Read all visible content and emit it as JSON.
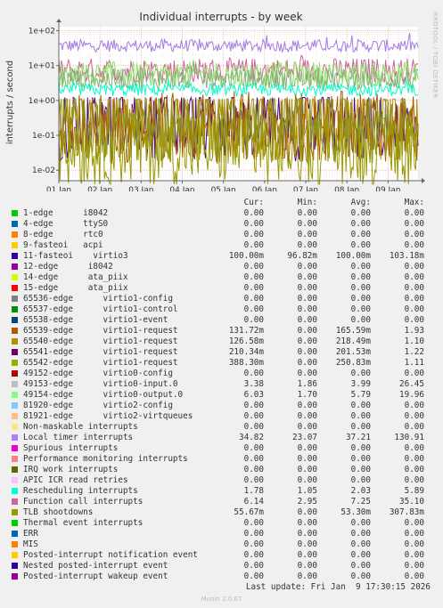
{
  "chart_data": {
    "type": "line",
    "title": "Individual interrupts - by week",
    "ylabel": "interrupts / second",
    "yscale": "log",
    "ylim": [
      0.005,
      130
    ],
    "ytick_labels": [
      "1e-02",
      "1e-01",
      "1e+00",
      "1e+01",
      "1e+02"
    ],
    "yticks": [
      0.01,
      0.1,
      1,
      10,
      100
    ],
    "xtick_labels": [
      "01 Jan",
      "02 Jan",
      "03 Jan",
      "04 Jan",
      "05 Jan",
      "06 Jan",
      "07 Jan",
      "08 Jan",
      "09 Jan"
    ],
    "xlim": [
      "01 Jan",
      "09 Jan 17:30"
    ],
    "grid": true,
    "watermark": "RRDTOOL / TOBI OETIKER",
    "series": [
      {
        "name": "Local timer interrupts",
        "color": "#a57be2",
        "avg": 37.21,
        "min": 23.07,
        "max": 130.91,
        "noise": 0.06
      },
      {
        "name": "Function call interrupts",
        "color": "#cc6699",
        "avg": 7.25,
        "min": 2.95,
        "max": 35.1,
        "noise": 0.12
      },
      {
        "name": "49154-edge virtio0-output.0",
        "color": "#8ee565",
        "avg": 5.79,
        "min": 1.7,
        "max": 19.96,
        "noise": 0.12
      },
      {
        "name": "49153-edge virtio0-input.0",
        "color": "#85b27a",
        "avg": 3.99,
        "min": 1.86,
        "max": 26.45,
        "noise": 0.1
      },
      {
        "name": "Rescheduling interrupts",
        "color": "#00ffcc",
        "avg": 2.03,
        "min": 1.05,
        "max": 5.89,
        "noise": 0.06
      },
      {
        "name": "65541-edge virtio1-request",
        "color": "#550088",
        "avg": 0.2015,
        "min": 0.01,
        "max": 1.22,
        "noise": 0.35
      },
      {
        "name": "65540-edge virtio1-request",
        "color": "#b89000",
        "avg": 0.2185,
        "min": 0.01,
        "max": 1.1,
        "noise": 0.35
      },
      {
        "name": "65539-edge virtio1-request",
        "color": "#a85c00",
        "avg": 0.1656,
        "min": 0.01,
        "max": 1.93,
        "noise": 0.35
      },
      {
        "name": "65542-edge virtio1-request",
        "color": "#889922",
        "avg": 0.2508,
        "min": 0.004,
        "max": 1.11,
        "noise": 0.4
      },
      {
        "name": "TLB shootdowns",
        "color": "#999900",
        "avg": 0.0533,
        "min": 0.004,
        "max": 0.3078,
        "noise": 0.4
      }
    ]
  },
  "legend": {
    "headers": {
      "cur": "Cur:",
      "min": "Min:",
      "avg": "Avg:",
      "max": "Max:"
    },
    "rows": [
      {
        "label": "1-edge      i8042",
        "color": "#00cc00",
        "cur": "0.00",
        "min": "0.00",
        "avg": "0.00",
        "max": "0.00"
      },
      {
        "label": "4-edge      ttyS0",
        "color": "#0066b3",
        "cur": "0.00",
        "min": "0.00",
        "avg": "0.00",
        "max": "0.00"
      },
      {
        "label": "8-edge      rtc0",
        "color": "#ff8000",
        "cur": "0.00",
        "min": "0.00",
        "avg": "0.00",
        "max": "0.00"
      },
      {
        "label": "9-fasteoi   acpi",
        "color": "#ffcc00",
        "cur": "0.00",
        "min": "0.00",
        "avg": "0.00",
        "max": "0.00"
      },
      {
        "label": "11-fasteoi    virtio3",
        "color": "#330099",
        "cur": "100.00m",
        "min": "96.82m",
        "avg": "100.00m",
        "max": "103.18m"
      },
      {
        "label": "12-edge      i8042",
        "color": "#990099",
        "cur": "0.00",
        "min": "0.00",
        "avg": "0.00",
        "max": "0.00"
      },
      {
        "label": "14-edge      ata_piix",
        "color": "#ccff00",
        "cur": "0.00",
        "min": "0.00",
        "avg": "0.00",
        "max": "0.00"
      },
      {
        "label": "15-edge      ata_piix",
        "color": "#ff0000",
        "cur": "0.00",
        "min": "0.00",
        "avg": "0.00",
        "max": "0.00"
      },
      {
        "label": "65536-edge      virtio1-config",
        "color": "#808080",
        "cur": "0.00",
        "min": "0.00",
        "avg": "0.00",
        "max": "0.00"
      },
      {
        "label": "65537-edge      virtio1-control",
        "color": "#008f00",
        "cur": "0.00",
        "min": "0.00",
        "avg": "0.00",
        "max": "0.00"
      },
      {
        "label": "65538-edge      virtio1-event",
        "color": "#00487d",
        "cur": "0.00",
        "min": "0.00",
        "avg": "0.00",
        "max": "0.00"
      },
      {
        "label": "65539-edge      virtio1-request",
        "color": "#b35a00",
        "cur": "131.72m",
        "min": "0.00",
        "avg": "165.59m",
        "max": "1.93"
      },
      {
        "label": "65540-edge      virtio1-request",
        "color": "#b38f00",
        "cur": "126.58m",
        "min": "0.00",
        "avg": "218.49m",
        "max": "1.10"
      },
      {
        "label": "65541-edge      virtio1-request",
        "color": "#6b006b",
        "cur": "210.34m",
        "min": "0.00",
        "avg": "201.53m",
        "max": "1.22"
      },
      {
        "label": "65542-edge      virtio1-request",
        "color": "#8fb300",
        "cur": "388.30m",
        "min": "0.00",
        "avg": "250.83m",
        "max": "1.11"
      },
      {
        "label": "49152-edge      virtio0-config",
        "color": "#b30000",
        "cur": "0.00",
        "min": "0.00",
        "avg": "0.00",
        "max": "0.00"
      },
      {
        "label": "49153-edge      virtio0-input.0",
        "color": "#bebebe",
        "cur": "3.38",
        "min": "1.86",
        "avg": "3.99",
        "max": "26.45"
      },
      {
        "label": "49154-edge      virtio0-output.0",
        "color": "#80ff80",
        "cur": "6.03",
        "min": "1.70",
        "avg": "5.79",
        "max": "19.96"
      },
      {
        "label": "81920-edge      virtio2-config",
        "color": "#80c9ff",
        "cur": "0.00",
        "min": "0.00",
        "avg": "0.00",
        "max": "0.00"
      },
      {
        "label": "81921-edge      virtio2-virtqueues",
        "color": "#ffc080",
        "cur": "0.00",
        "min": "0.00",
        "avg": "0.00",
        "max": "0.00"
      },
      {
        "label": "Non-maskable interrupts",
        "color": "#ffe680",
        "cur": "0.00",
        "min": "0.00",
        "avg": "0.00",
        "max": "0.00"
      },
      {
        "label": "Local timer interrupts",
        "color": "#aa80ff",
        "cur": "34.82",
        "min": "23.07",
        "avg": "37.21",
        "max": "130.91"
      },
      {
        "label": "Spurious interrupts",
        "color": "#ee00cc",
        "cur": "0.00",
        "min": "0.00",
        "avg": "0.00",
        "max": "0.00"
      },
      {
        "label": "Performance monitoring interrupts",
        "color": "#ff8080",
        "cur": "0.00",
        "min": "0.00",
        "avg": "0.00",
        "max": "0.00"
      },
      {
        "label": "IRQ work interrupts",
        "color": "#666600",
        "cur": "0.00",
        "min": "0.00",
        "avg": "0.00",
        "max": "0.00"
      },
      {
        "label": "APIC ICR read retries",
        "color": "#ffbfff",
        "cur": "0.00",
        "min": "0.00",
        "avg": "0.00",
        "max": "0.00"
      },
      {
        "label": "Rescheduling interrupts",
        "color": "#00ffcc",
        "cur": "1.78",
        "min": "1.05",
        "avg": "2.03",
        "max": "5.89"
      },
      {
        "label": "Function call interrupts",
        "color": "#cc6699",
        "cur": "6.14",
        "min": "2.95",
        "avg": "7.25",
        "max": "35.10"
      },
      {
        "label": "TLB shootdowns",
        "color": "#999900",
        "cur": "55.67m",
        "min": "0.00",
        "avg": "53.30m",
        "max": "307.83m"
      },
      {
        "label": "Thermal event interrupts",
        "color": "#00cc00",
        "cur": "0.00",
        "min": "0.00",
        "avg": "0.00",
        "max": "0.00"
      },
      {
        "label": "ERR",
        "color": "#0066b3",
        "cur": "0.00",
        "min": "0.00",
        "avg": "0.00",
        "max": "0.00"
      },
      {
        "label": "MIS",
        "color": "#ff8000",
        "cur": "0.00",
        "min": "0.00",
        "avg": "0.00",
        "max": "0.00"
      },
      {
        "label": "Posted-interrupt notification event",
        "color": "#ffcc00",
        "cur": "0.00",
        "min": "0.00",
        "avg": "0.00",
        "max": "0.00"
      },
      {
        "label": "Nested posted-interrupt event",
        "color": "#330099",
        "cur": "0.00",
        "min": "0.00",
        "avg": "0.00",
        "max": "0.00"
      },
      {
        "label": "Posted-interrupt wakeup event",
        "color": "#990099",
        "cur": "0.00",
        "min": "0.00",
        "avg": "0.00",
        "max": "0.00"
      }
    ]
  },
  "footer": {
    "last_update": "Last update: Fri Jan  9 17:30:15 2026",
    "version": "Munin 2.0.67"
  }
}
